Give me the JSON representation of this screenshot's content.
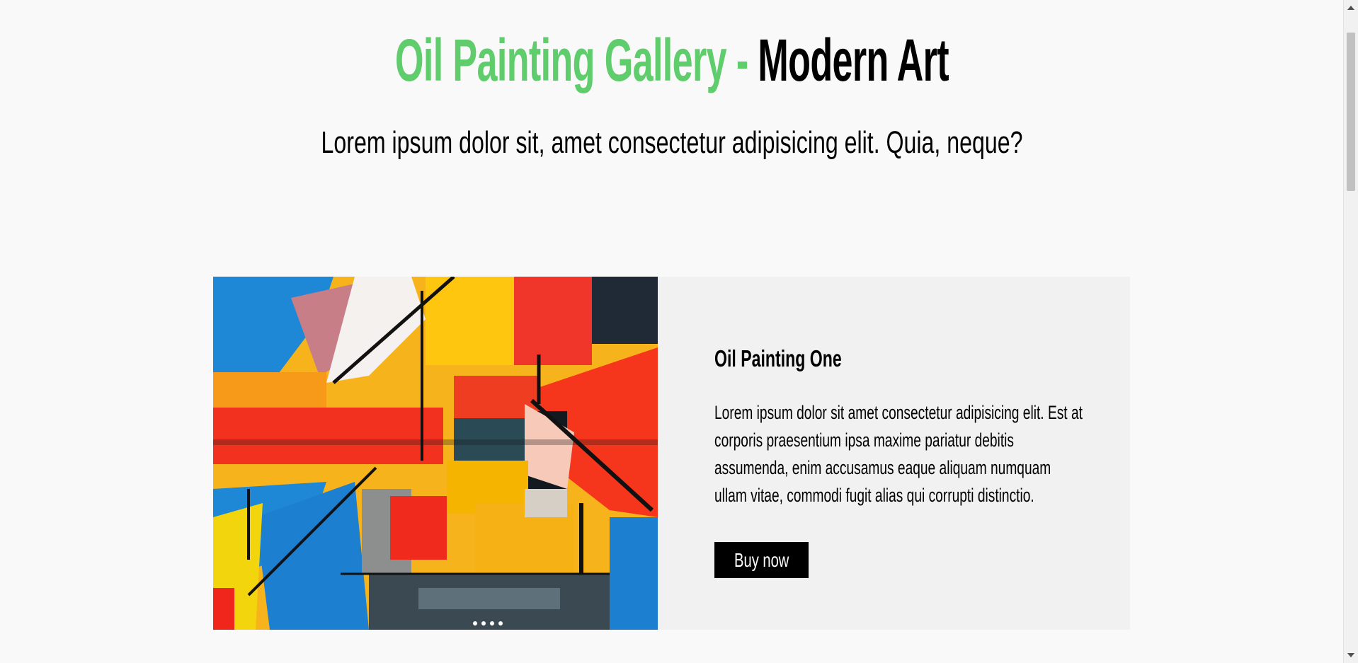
{
  "header": {
    "title_part1": "Oil Painting Gallery - ",
    "title_part2": "Modern Art",
    "subtitle": "Lorem ipsum dolor sit, amet consectetur adipisicing elit. Quia, neque?",
    "accent_color": "#5fcd6b"
  },
  "card": {
    "image_icon": "abstract-oil-painting-image",
    "title": "Oil Painting One",
    "text": "Lorem ipsum dolor sit amet consectetur adipisicing elit. Est at corporis praesentium ipsa maxime pariatur debitis assumenda, enim accusamus eaque aliquam numquam ullam vitae, commodi fugit alias qui corrupti distinctio.",
    "button_label": "Buy now"
  },
  "scrollbar": {
    "icon_up": "scroll-up-arrow-icon",
    "icon_down": "scroll-down-arrow-icon"
  }
}
